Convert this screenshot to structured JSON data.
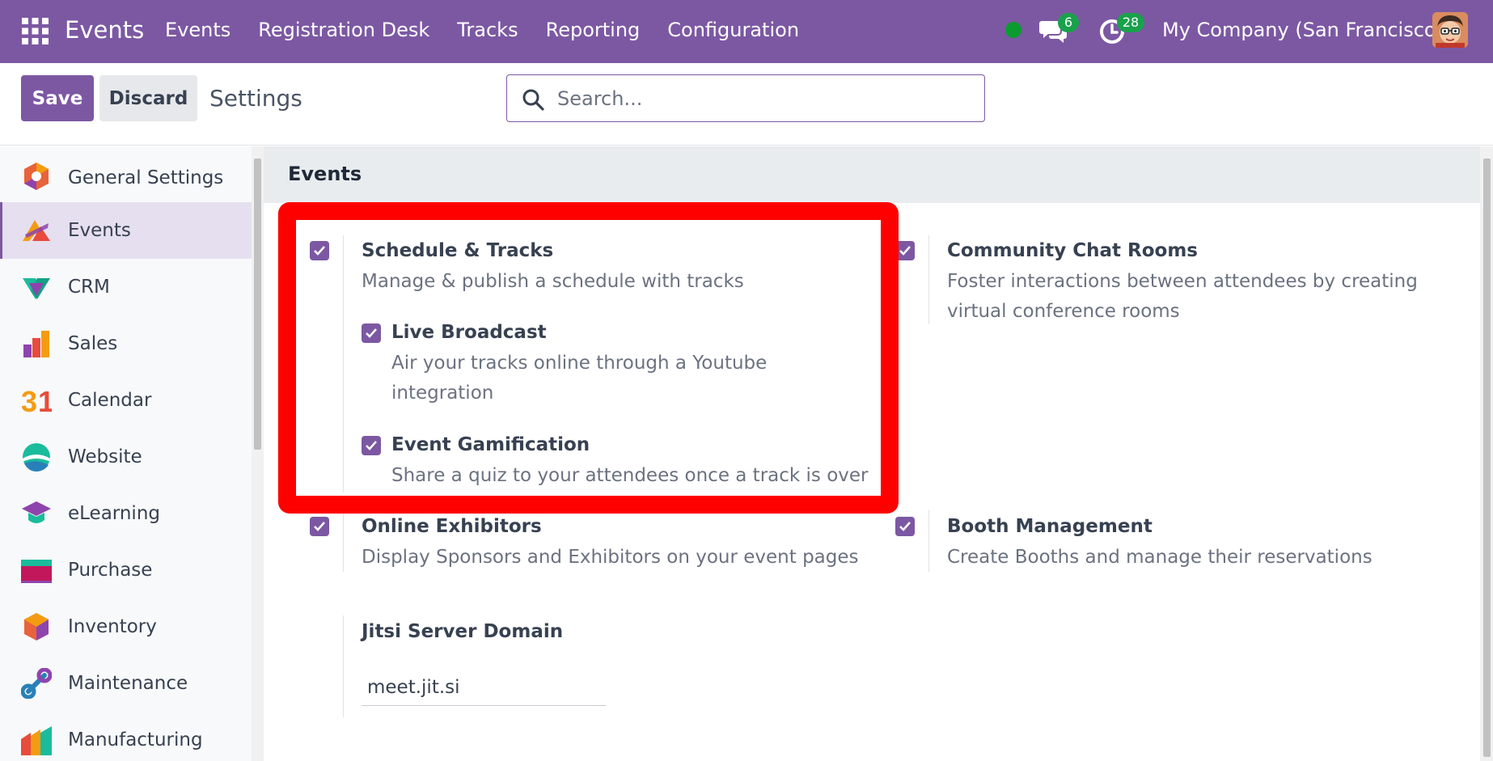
{
  "navbar": {
    "app_title": "Events",
    "menu": [
      "Events",
      "Registration Desk",
      "Tracks",
      "Reporting",
      "Configuration"
    ],
    "messages_count": "6",
    "activities_count": "28",
    "company": "My Company (San Francisco)"
  },
  "control": {
    "save_label": "Save",
    "discard_label": "Discard",
    "breadcrumb": "Settings",
    "search_placeholder": "Search..."
  },
  "sidebar": {
    "items": [
      {
        "label": "General Settings",
        "icon": "general-settings-icon"
      },
      {
        "label": "Events",
        "icon": "events-icon",
        "active": true
      },
      {
        "label": "CRM",
        "icon": "crm-icon"
      },
      {
        "label": "Sales",
        "icon": "sales-icon"
      },
      {
        "label": "Calendar",
        "icon": "calendar-icon"
      },
      {
        "label": "Website",
        "icon": "website-icon"
      },
      {
        "label": "eLearning",
        "icon": "elearning-icon"
      },
      {
        "label": "Purchase",
        "icon": "purchase-icon"
      },
      {
        "label": "Inventory",
        "icon": "inventory-icon"
      },
      {
        "label": "Maintenance",
        "icon": "maintenance-icon"
      },
      {
        "label": "Manufacturing",
        "icon": "manufacturing-icon"
      }
    ]
  },
  "main": {
    "section_title": "Events",
    "settings": {
      "schedule_tracks": {
        "title": "Schedule & Tracks",
        "desc": "Manage & publish a schedule with tracks",
        "checked": true
      },
      "live_broadcast": {
        "title": "Live Broadcast",
        "desc": "Air your tracks online through a Youtube integration",
        "checked": true
      },
      "event_gamification": {
        "title": "Event Gamification",
        "desc": "Share a quiz to your attendees once a track is over",
        "checked": true
      },
      "community_chat": {
        "title": "Community Chat Rooms",
        "desc": "Foster interactions between attendees by creating virtual conference rooms",
        "checked": true
      },
      "online_exhibitors": {
        "title": "Online Exhibitors",
        "desc": "Display Sponsors and Exhibitors on your event pages",
        "checked": true
      },
      "booth_management": {
        "title": "Booth Management",
        "desc": "Create Booths and manage their reservations",
        "checked": true
      },
      "jitsi": {
        "title": "Jitsi Server Domain",
        "value": "meet.jit.si"
      }
    }
  },
  "colors": {
    "brand": "#7c58a3",
    "highlight": "#ff0000",
    "badge": "#1aa14c",
    "online": "#0c9b2f"
  }
}
